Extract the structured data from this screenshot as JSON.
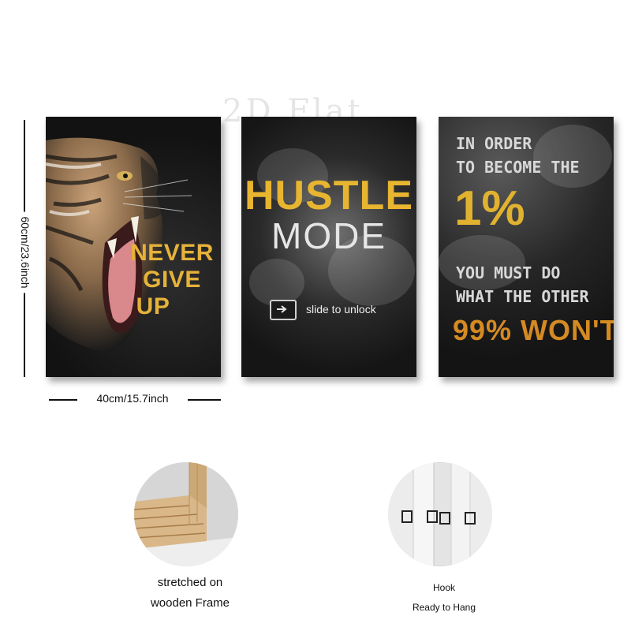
{
  "watermark": "2D Flat",
  "dimensions": {
    "height_label": "60cm/23.6inch",
    "width_label": "40cm/15.7inch"
  },
  "panels": {
    "tiger": {
      "line1": "NEVER",
      "line2": "GIVE",
      "line3": "UP"
    },
    "hustle": {
      "title_top": "HUSTLE",
      "title_bottom": "MODE",
      "slider_text": "slide to unlock"
    },
    "one_percent": {
      "line1": "IN ORDER",
      "line2": "TO BECOME THE",
      "big": "1%",
      "line3": "YOU MUST DO",
      "line4": "WHAT THE OTHER",
      "bottom": "99% WON'T"
    }
  },
  "details": {
    "frame": {
      "caption_line1": "stretched on",
      "caption_line2": "wooden Frame"
    },
    "hook": {
      "caption_line1": "Hook",
      "caption_line2": "Ready to Hang"
    }
  },
  "colors": {
    "gold": "#e5b23a",
    "orange": "#d58a22",
    "panel_dark": "#141414"
  }
}
